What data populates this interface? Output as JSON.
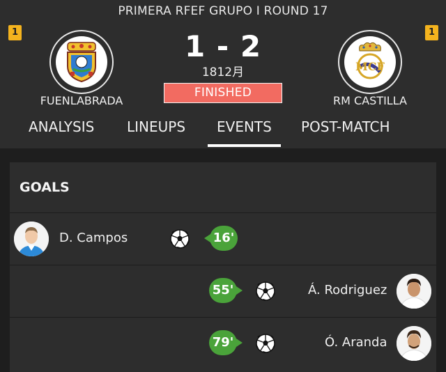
{
  "match": {
    "competition": "PRIMERA RFEF  GRUPO I ROUND 17",
    "score": "1 - 2",
    "date": "1812月",
    "status": "FINISHED",
    "home": {
      "name": "FUENLABRADA",
      "cards": "1"
    },
    "away": {
      "name": "RM CASTILLA",
      "cards": "1"
    }
  },
  "tabs": [
    "ANALYSIS",
    "LINEUPS",
    "EVENTS",
    "POST-MATCH"
  ],
  "active_tab": "EVENTS",
  "goals": {
    "title": "GOALS",
    "events": [
      {
        "side": "home",
        "player": "D. Campos",
        "minute": "16'"
      },
      {
        "side": "away",
        "player": "Á. Rodriguez",
        "minute": "55'"
      },
      {
        "side": "away",
        "player": "Ó. Aranda",
        "minute": "79'"
      }
    ]
  },
  "colors": {
    "header_bg": "#2d2d2d",
    "page_bg": "#1e1e1e",
    "status_bg": "#f26b61",
    "minute_badge": "#4aa33a",
    "card_yellow": "#f4b31e"
  },
  "icons": {
    "home_crest": "fuenlabrada-crest-icon",
    "away_crest": "real-madrid-crest-icon",
    "goal": "soccer-ball-icon"
  }
}
